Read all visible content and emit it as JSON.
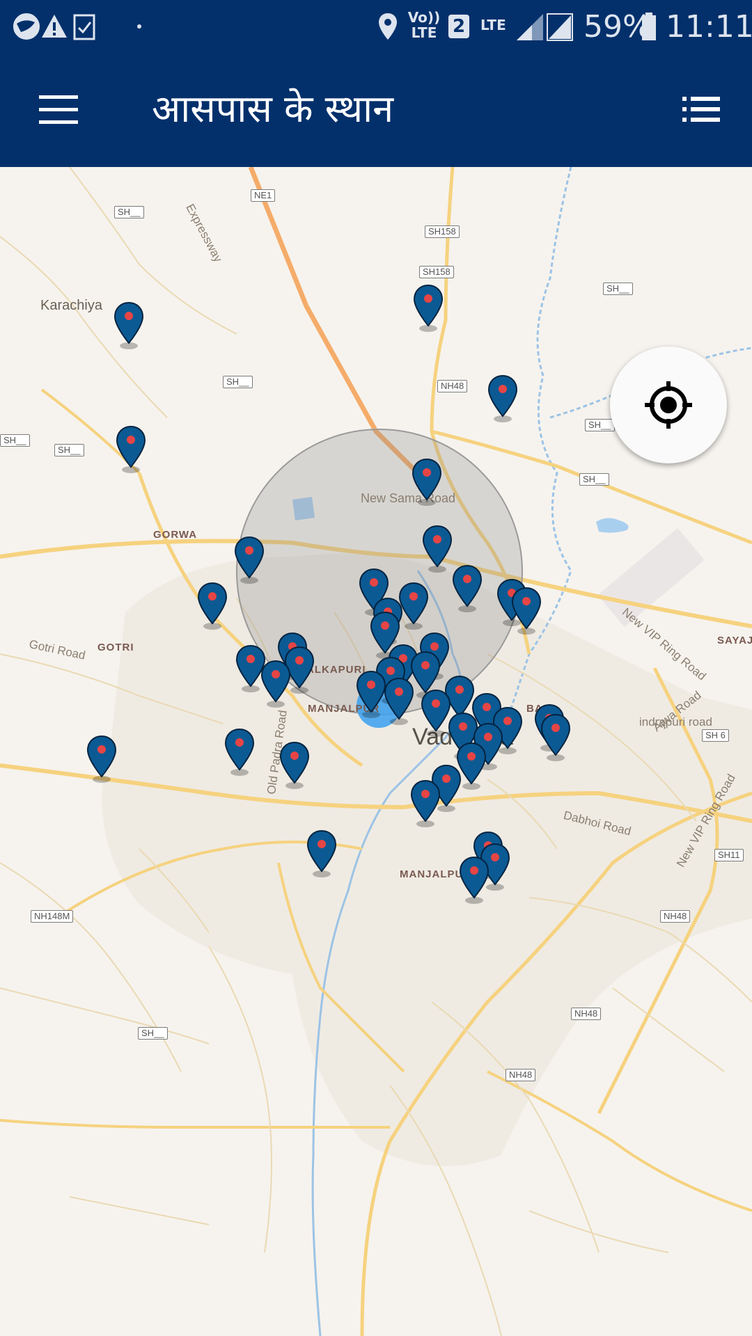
{
  "status_bar": {
    "network": "Vo)) LTE",
    "sim_slot": "2",
    "lte": "LTE",
    "battery": "59%",
    "time": "11:11",
    "icons": [
      "globe-icon",
      "warning-icon",
      "clipboard-check-icon",
      "dot-icon",
      "location-pin-icon",
      "signal-icon",
      "battery-icon"
    ]
  },
  "app_bar": {
    "title": "आसपास के स्थान",
    "menu_icon": "hamburger-menu-icon",
    "list_icon": "list-view-icon"
  },
  "map": {
    "places": [
      "Karachiya",
      "GORWA",
      "GOTRI",
      "ALKAPURI",
      "MANJALPUR",
      "MANJALPUR",
      "Vadodara",
      "SAYAJI",
      "BA"
    ],
    "roads": [
      "Expressway",
      "New Sama Road",
      "Gotri Road",
      "Old Padra Road",
      "New VIP Ring Road",
      "New VIP Ring Road",
      "Ajwa Road",
      "indrapuri road",
      "Dabhoi Road"
    ],
    "shields": [
      "NE1",
      "SH158",
      "SH158",
      "SH__",
      "SH__",
      "SH__",
      "SH__",
      "SH__",
      "SH__",
      "SH__",
      "NH48",
      "NH48",
      "NH48",
      "NH48",
      "SH 6",
      "SH11",
      "NH148M",
      "SH__"
    ],
    "marker_color": "#0b5a94",
    "marker_dot_color": "#e64545",
    "accuracy_circle_color": "#8a8a8a",
    "user_location_color": "#39a0ee",
    "locate_icon": "my-location-crosshair-icon"
  }
}
